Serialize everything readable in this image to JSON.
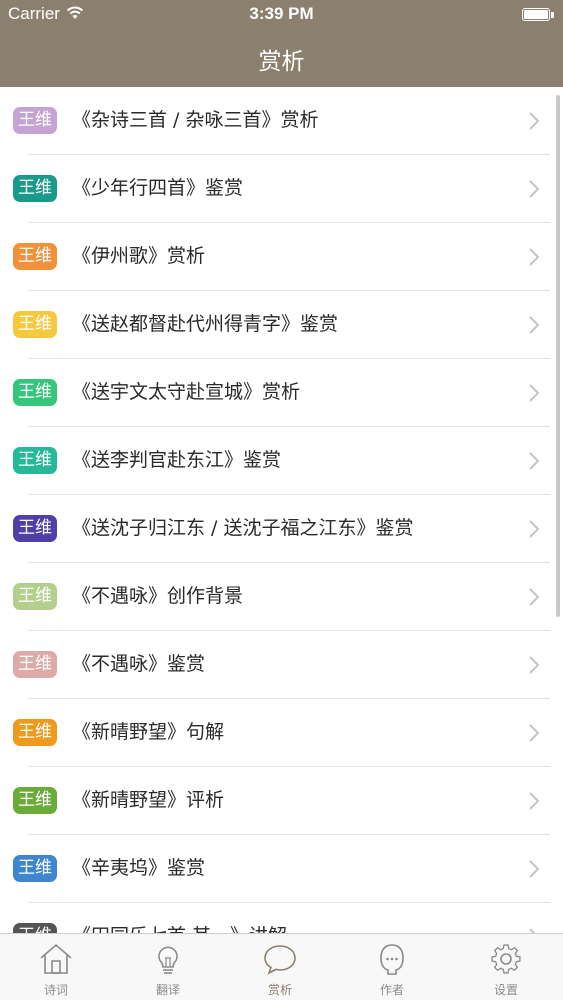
{
  "status_bar": {
    "carrier": "Carrier",
    "time": "3:39 PM"
  },
  "nav": {
    "title": "赏析"
  },
  "items": [
    {
      "author": "王维",
      "title": "《杂诗三首 / 杂咏三首》赏析",
      "color": "#c5a3d3"
    },
    {
      "author": "王维",
      "title": "《少年行四首》鉴赏",
      "color": "#1a9a8a"
    },
    {
      "author": "王维",
      "title": "《伊州歌》赏析",
      "color": "#f1913a"
    },
    {
      "author": "王维",
      "title": "《送赵都督赴代州得青字》鉴赏",
      "color": "#f5c93e"
    },
    {
      "author": "王维",
      "title": "《送宇文太守赴宣城》赏析",
      "color": "#34c77b"
    },
    {
      "author": "王维",
      "title": "《送李判官赴东江》鉴赏",
      "color": "#27b89a"
    },
    {
      "author": "王维",
      "title": "《送沈子归江东 / 送沈子福之江东》鉴赏",
      "color": "#4f3fa8"
    },
    {
      "author": "王维",
      "title": "《不遇咏》创作背景",
      "color": "#b3cf8e"
    },
    {
      "author": "王维",
      "title": "《不遇咏》鉴赏",
      "color": "#dcaaa8"
    },
    {
      "author": "王维",
      "title": "《新晴野望》句解",
      "color": "#ee9a1c"
    },
    {
      "author": "王维",
      "title": "《新晴野望》评析",
      "color": "#6aab3a"
    },
    {
      "author": "王维",
      "title": "《辛夷坞》鉴赏",
      "color": "#3e86cf"
    },
    {
      "author": "王维",
      "title": "《田园乐七首·其一》讲解",
      "color": "#555555"
    }
  ],
  "tabs": [
    {
      "label": "诗词",
      "icon": "house-icon"
    },
    {
      "label": "翻译",
      "icon": "lightbulb-icon"
    },
    {
      "label": "赏析",
      "icon": "speech-bubble-icon",
      "active": true
    },
    {
      "label": "作者",
      "icon": "person-icon"
    },
    {
      "label": "设置",
      "icon": "gear-icon"
    }
  ],
  "colors": {
    "accent": "#8b7f70",
    "tab_inactive": "#8b8b8b"
  }
}
